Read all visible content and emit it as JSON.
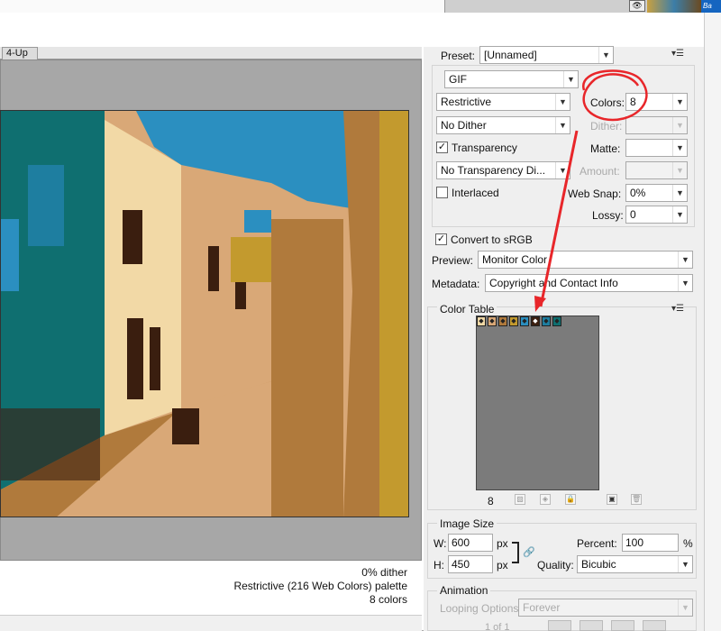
{
  "preset": {
    "label": "Preset:",
    "value": "[Unnamed]"
  },
  "format": "GIF",
  "reduction": {
    "value": "Restrictive"
  },
  "colors": {
    "label": "Colors:",
    "value": "8"
  },
  "dither": {
    "value": "No Dither",
    "label": "Dither:",
    "amount": ""
  },
  "transparency": {
    "label": "Transparency",
    "checked": true
  },
  "matte": {
    "label": "Matte:",
    "value": ""
  },
  "transparency_dither": {
    "value": "No Transparency Di...",
    "amount_label": "Amount:"
  },
  "interlaced": {
    "label": "Interlaced",
    "checked": false
  },
  "web_snap": {
    "label": "Web Snap:",
    "value": "0%"
  },
  "lossy": {
    "label": "Lossy:",
    "value": "0"
  },
  "convert_srgb": {
    "label": "Convert to sRGB",
    "checked": true
  },
  "preview": {
    "label": "Preview:",
    "value": "Monitor Color"
  },
  "metadata": {
    "label": "Metadata:",
    "value": "Copyright and Contact Info"
  },
  "color_table": {
    "title": "Color Table",
    "count": "8",
    "swatches": [
      "#f2d9a6",
      "#d9a877",
      "#b07a3c",
      "#c39a2e",
      "#2b8fc0",
      "#3a1e0f",
      "#1e7ea0",
      "#0f6f70"
    ]
  },
  "image_size": {
    "title": "Image Size",
    "w_label": "W:",
    "w": "600",
    "h_label": "H:",
    "h": "450",
    "unit": "px",
    "percent_label": "Percent:",
    "percent": "100",
    "percent_unit": "%",
    "quality_label": "Quality:",
    "quality": "Bicubic"
  },
  "animation": {
    "title": "Animation",
    "looping_label": "Looping Options:",
    "looping": "Forever",
    "frame": "1 of 1"
  },
  "tab": "4-Up",
  "info": {
    "dither": "0% dither",
    "palette": "Restrictive (216 Web Colors) palette",
    "colors": "8 colors"
  },
  "panel_tag": "Ba"
}
